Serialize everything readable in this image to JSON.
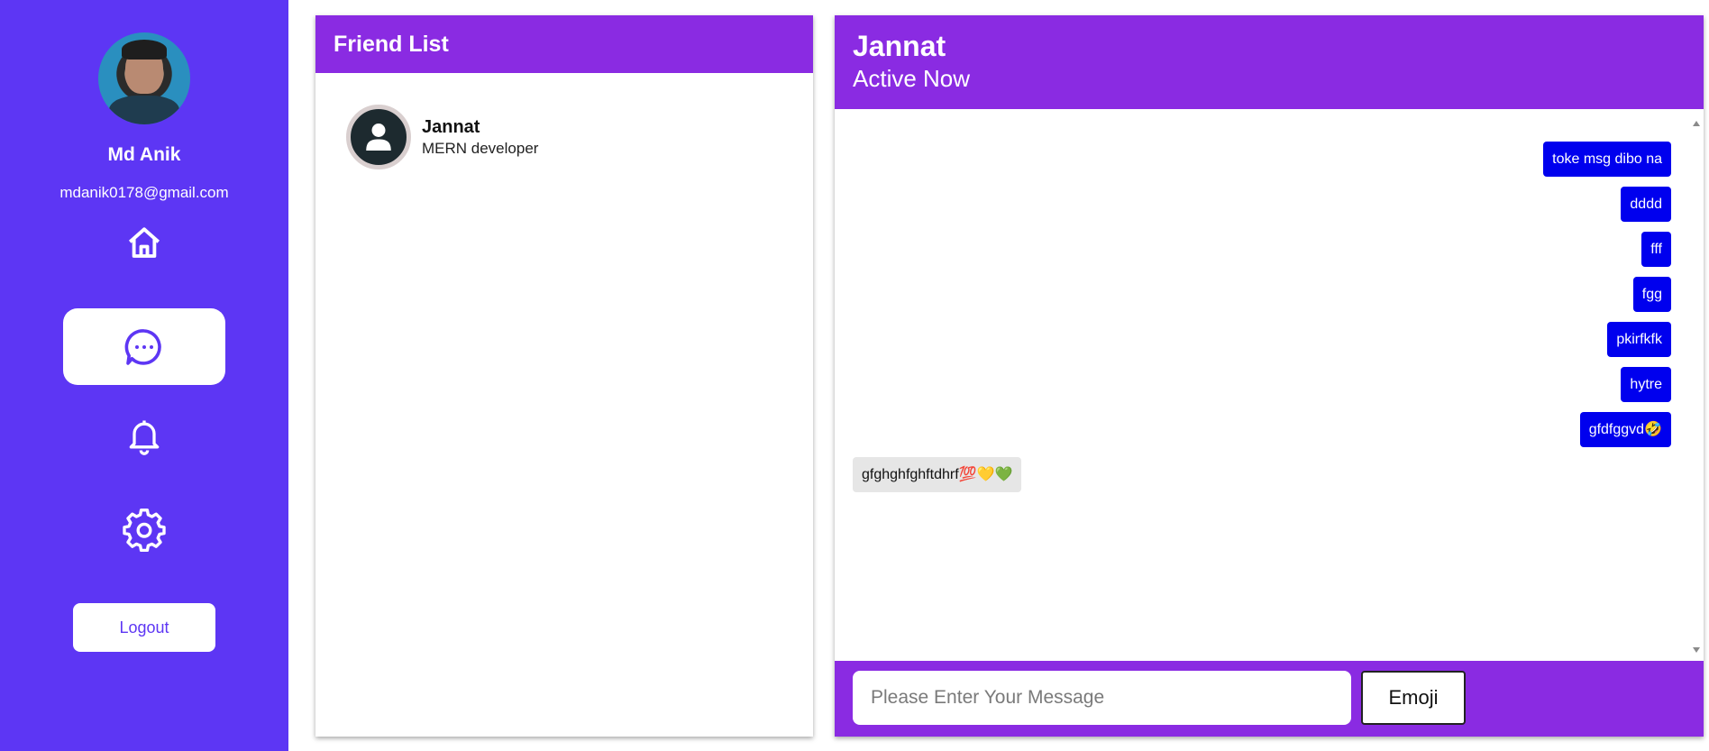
{
  "user": {
    "name": "Md Anik",
    "email": "mdanik0178@gmail.com"
  },
  "nav": {
    "items": [
      {
        "icon": "home-icon",
        "active": false
      },
      {
        "icon": "chat-dots-icon",
        "active": true
      },
      {
        "icon": "bell-icon",
        "active": false
      },
      {
        "icon": "gear-icon",
        "active": false
      }
    ],
    "logout_label": "Logout"
  },
  "friends": {
    "title": "Friend List",
    "items": [
      {
        "name": "Jannat",
        "role": "MERN developer"
      }
    ]
  },
  "chat": {
    "name": "Jannat",
    "status": "Active Now",
    "messages": [
      {
        "text": "toke msg dibo na",
        "from": "me"
      },
      {
        "text": "dddd",
        "from": "me"
      },
      {
        "text": "fff",
        "from": "me"
      },
      {
        "text": "fgg",
        "from": "me"
      },
      {
        "text": "pkirfkfk",
        "from": "me"
      },
      {
        "text": "hytre",
        "from": "me"
      },
      {
        "text": "gfdfggvd🤣",
        "from": "me"
      },
      {
        "text": "gfghghfghftdhrf💯💛💚",
        "from": "them"
      }
    ],
    "input_placeholder": "Please Enter Your Message",
    "input_value": "",
    "emoji_label": "Emoji"
  },
  "colors": {
    "sidebar": "#5d36f4",
    "header": "#8a2be2",
    "sent_bubble": "#0000ee",
    "received_bubble": "#e6e6e6"
  }
}
